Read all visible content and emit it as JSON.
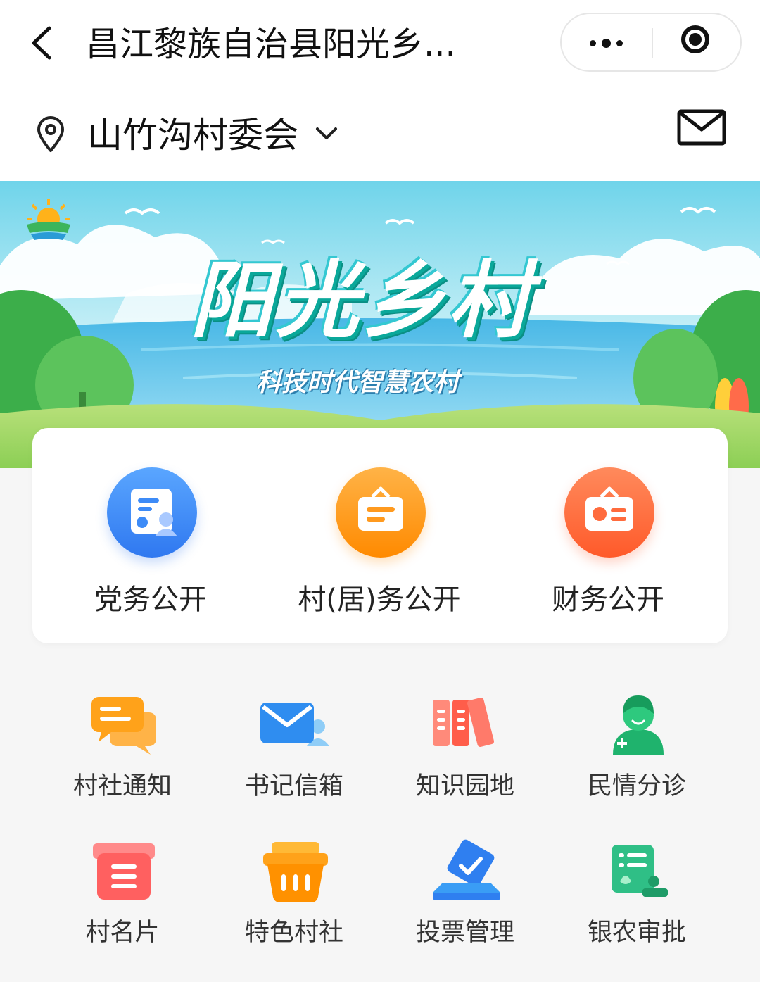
{
  "nav": {
    "title": "昌江黎族自治县阳光乡...",
    "back_icon": "chevron-left-icon",
    "more_icon": "more-dots-icon",
    "close_icon": "target-close-icon"
  },
  "location": {
    "name": "山竹沟村委会",
    "pin_icon": "location-pin-icon",
    "dropdown_icon": "chevron-down-icon",
    "mail_icon": "mail-icon"
  },
  "banner": {
    "title": "阳光乡村",
    "subtitle": "科技时代智慧农村",
    "logo_icon": "sun-logo-icon"
  },
  "card": {
    "items": [
      {
        "label": "党务公开",
        "icon": "party-affairs-icon",
        "color": "#3d8bf7"
      },
      {
        "label": "村(居)务公开",
        "icon": "village-affairs-icon",
        "color": "#ff9a1f"
      },
      {
        "label": "财务公开",
        "icon": "finance-icon",
        "color": "#ff6b3d"
      }
    ]
  },
  "grid": {
    "items": [
      {
        "label": "村社通知",
        "icon": "notification-chat-icon"
      },
      {
        "label": "书记信箱",
        "icon": "secretary-mailbox-icon"
      },
      {
        "label": "知识园地",
        "icon": "books-icon"
      },
      {
        "label": "民情分诊",
        "icon": "doctor-icon"
      },
      {
        "label": "村名片",
        "icon": "village-card-icon"
      },
      {
        "label": "特色村社",
        "icon": "basket-icon"
      },
      {
        "label": "投票管理",
        "icon": "vote-box-icon"
      },
      {
        "label": "银农审批",
        "icon": "approval-doc-icon"
      }
    ]
  },
  "colors": {
    "accent_blue": "#3d8bf7",
    "accent_orange": "#ff9a1f",
    "accent_red": "#ff6b3d",
    "green": "#22b573"
  }
}
